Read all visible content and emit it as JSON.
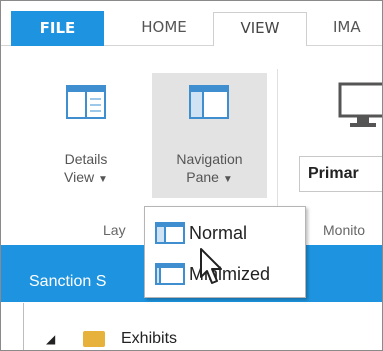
{
  "tabs": [
    {
      "label": "FILE"
    },
    {
      "label": "HOME"
    },
    {
      "label": "VIEW"
    },
    {
      "label": "IMA"
    }
  ],
  "ribbon": {
    "details_view": {
      "line1": "Details",
      "line2": "View",
      "icon": "details-view-icon"
    },
    "navigation_pane": {
      "line1": "Navigation",
      "line2": "Pane",
      "icon": "navigation-pane-icon"
    },
    "layout_group_label": "Lay",
    "monitor_group_label": "Monito",
    "monitor_select_value": "Primar"
  },
  "nav_pane_menu": {
    "items": [
      {
        "label": "Normal",
        "icon": "pane-normal-icon"
      },
      {
        "label": "Minimized",
        "icon": "pane-minimized-icon"
      }
    ]
  },
  "panel": {
    "title": "Sanction S",
    "tree_items": [
      {
        "label": "Exhibits",
        "icon": "folder-icon"
      }
    ]
  },
  "colors": {
    "accent": "#1e94e0",
    "nav_button_bg": "#e3e3e3"
  }
}
